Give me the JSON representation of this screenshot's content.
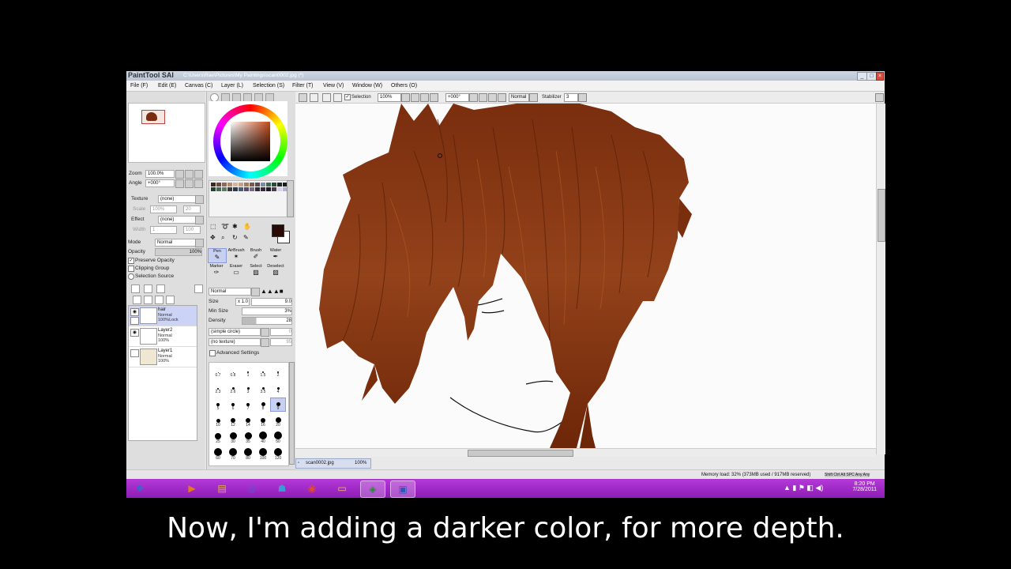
{
  "window": {
    "logo": "PaintTool SAI",
    "title_path": "C:\\Users\\Rae\\Pictures\\My Paintings\\scan0002.jpg (*)",
    "controls": [
      "_",
      "□",
      "×"
    ]
  },
  "menu": [
    {
      "label": "File (F)"
    },
    {
      "label": "Edit (E)"
    },
    {
      "label": "Canvas (C)"
    },
    {
      "label": "Layer (L)"
    },
    {
      "label": "Selection (S)"
    },
    {
      "label": "Filter (T)"
    },
    {
      "label": "View (V)"
    },
    {
      "label": "Window (W)"
    },
    {
      "label": "Others (O)"
    }
  ],
  "navigator": {
    "zoom_label": "Zoom",
    "zoom_value": "100.0%",
    "angle_label": "Angle",
    "angle_value": "+000°"
  },
  "texture": {
    "label": "Texture",
    "value": "(none)",
    "scale_label": "Scale",
    "scale_value": "100%",
    "strength_label": "Str",
    "strength_value": "20"
  },
  "effect": {
    "label": "Effect",
    "value": "(none)",
    "width_label": "Width",
    "width_value": "1",
    "strength_label": "Stren",
    "strength_value": "100"
  },
  "layer_props": {
    "mode_label": "Mode",
    "mode_value": "Normal",
    "opacity_label": "Opacity",
    "opacity_value": "100%",
    "preserve_opacity": "Preserve Opacity",
    "clipping_group": "Clipping Group",
    "selection_source": "Selection Source"
  },
  "layers": [
    {
      "name": "hair",
      "mode": "Normal",
      "opacity": "100%Lock",
      "selected": true
    },
    {
      "name": "Layer2",
      "mode": "Normal",
      "opacity": "100%",
      "selected": false
    },
    {
      "name": "Layer1",
      "mode": "Normal",
      "opacity": "100%",
      "selected": false
    }
  ],
  "tools": [
    {
      "label": "Pen",
      "icon": "pen-icon",
      "glyph": "✎",
      "selected": true
    },
    {
      "label": "AirBrush",
      "icon": "airbrush-icon",
      "glyph": "✶",
      "selected": false
    },
    {
      "label": "Brush",
      "icon": "brush-icon",
      "glyph": "✐",
      "selected": false
    },
    {
      "label": "Water",
      "icon": "water-icon",
      "glyph": "✒",
      "selected": false
    },
    {
      "label": "Marker",
      "icon": "marker-icon",
      "glyph": "✑",
      "selected": false
    },
    {
      "label": "Eraser",
      "icon": "eraser-icon",
      "glyph": "▭",
      "selected": false
    },
    {
      "label": "Select",
      "icon": "select-icon",
      "glyph": "▨",
      "selected": false
    },
    {
      "label": "Deselect",
      "icon": "deselect-icon",
      "glyph": "▧",
      "selected": false
    }
  ],
  "brush": {
    "blend_value": "Normal",
    "size_label": "Size",
    "size_mult": "x 1.0",
    "size_value": "9.0",
    "minsize_label": "Min Size",
    "minsize_value": "3%",
    "density_label": "Density",
    "density_value": "28",
    "shape_value": "(simple circle)",
    "shape_num": "0",
    "texture_value": "(no texture)",
    "texture_num": "95",
    "advanced": "Advanced Settings"
  },
  "brush_sizes": [
    "0.7",
    "0.8",
    "1",
    "1.5",
    "2",
    "2.3",
    "2.6",
    "3",
    "3.5",
    "4",
    "5",
    "6",
    "7",
    "8",
    "9",
    "10",
    "12",
    "14",
    "16",
    "20",
    "25",
    "30",
    "35",
    "40",
    "50",
    "60",
    "70",
    "80",
    "100",
    "120"
  ],
  "toolbar": {
    "selection_label": "Selection",
    "zoom_value": "100%",
    "angle_value": "+000°",
    "mode_value": "Normal",
    "stabilizer_label": "Stabilizer",
    "stabilizer_value": "3"
  },
  "doc_tab": {
    "name": "scan0002.jpg",
    "zoom": "100%"
  },
  "status": {
    "memory": "Memory load: 32% (373MB used / 917MB reserved)",
    "keys": "Shift Ctrl Alt SPC Any Any"
  },
  "taskbar": {
    "time": "8:20 PM",
    "date": "7/28/2011",
    "apps": [
      "start-orb-icon",
      "media-player-icon",
      "explorer-icon",
      "firefox-icon",
      "messenger-icon",
      "chrome-icon",
      "folder-icon",
      "photoshop-icon",
      "paint-tool-sai-icon"
    ]
  },
  "subtitle": "Now, I'm adding a darker color, for more depth.",
  "colors": {
    "hair_base": "#8a3a12",
    "hair_dark": "#5a2008",
    "hair_light": "#b35a22",
    "taskbar": "#9c28c8",
    "selection_highlight": "#c7d0f0"
  }
}
